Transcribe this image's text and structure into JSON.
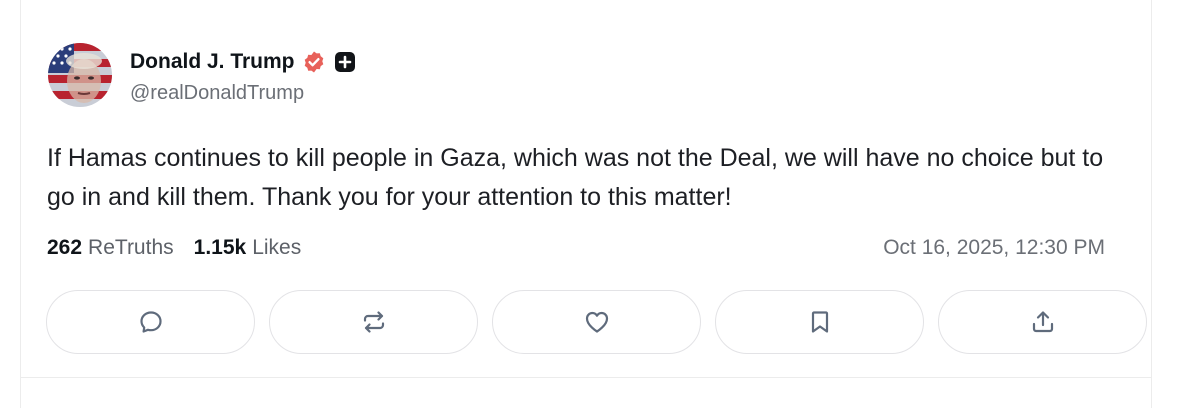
{
  "author": {
    "name": "Donald J. Trump",
    "handle": "@realDonaldTrump",
    "verified_color": "#e8615a",
    "badge_icon": "plus-badge-icon"
  },
  "post": {
    "text": "If Hamas continues to kill people in Gaza, which was not the Deal, we will have no choice but to go in and kill them. Thank you for your attention to this matter!"
  },
  "stats": {
    "retruths_count": "262",
    "retruths_label": "ReTruths",
    "likes_count": "1.15k",
    "likes_label": "Likes",
    "timestamp": "Oct 16, 2025, 12:30 PM"
  },
  "actions": [
    {
      "name": "reply",
      "icon": "comment-icon"
    },
    {
      "name": "retruth",
      "icon": "repost-icon"
    },
    {
      "name": "like",
      "icon": "heart-icon"
    },
    {
      "name": "bookmark",
      "icon": "bookmark-icon"
    },
    {
      "name": "share",
      "icon": "share-icon"
    }
  ]
}
